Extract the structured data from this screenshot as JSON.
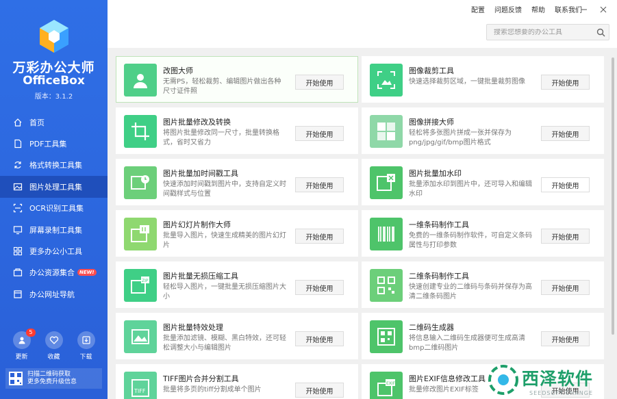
{
  "app": {
    "title": "万彩办公大师",
    "subtitle": "OfficeBox",
    "version": "版本：3.1.2"
  },
  "topmenu": [
    "配置",
    "问题反馈",
    "帮助",
    "联系我们"
  ],
  "search": {
    "placeholder": "搜索您想要的办公工具"
  },
  "nav": [
    {
      "label": "首页",
      "icon": "home-icon"
    },
    {
      "label": "PDF工具集",
      "icon": "pdf-icon"
    },
    {
      "label": "格式转换工具集",
      "icon": "convert-icon"
    },
    {
      "label": "图片处理工具集",
      "icon": "image-icon"
    },
    {
      "label": "OCR识别工具集",
      "icon": "ocr-icon"
    },
    {
      "label": "屏幕录制工具集",
      "icon": "monitor-icon"
    },
    {
      "label": "更多办公小工具",
      "icon": "grid-icon"
    },
    {
      "label": "办公资源集合",
      "icon": "resource-icon",
      "badge": "NEW!"
    },
    {
      "label": "办公网址导航",
      "icon": "nav-icon"
    }
  ],
  "bottom": {
    "update": {
      "label": "更新",
      "count": "5"
    },
    "favorite": {
      "label": "收藏"
    },
    "download": {
      "label": "下载"
    },
    "qr_line1": "扫描二维码获取",
    "qr_line2": "更多免费升级信息"
  },
  "button_label": "开始使用",
  "cards": [
    {
      "title": "改图大师",
      "desc": "无需PS，轻松裁剪、编辑图片做出各种尺寸证件照",
      "icon": "id-photo-icon",
      "color": "#4fcf88"
    },
    {
      "title": "图像裁剪工具",
      "desc": "快速选择裁剪区域，一键批量裁剪图像",
      "icon": "crop-frame-icon",
      "color": "#3fcf86"
    },
    {
      "title": "图片批量修改及转换",
      "desc": "将图片批量修改同一尺寸，批量转换格式，省时又省力",
      "icon": "crop-icon",
      "color": "#3fcf86"
    },
    {
      "title": "图像拼接大师",
      "desc": "轻松将多张图片拼成一张并保存为png/jpg/gif/bmp图片格式",
      "icon": "stitch-icon",
      "color": "#8fd8a8"
    },
    {
      "title": "图片批量加时间戳工具",
      "desc": "快速添加时间戳到图片中，支持自定义时间戳样式与位置",
      "icon": "timestamp-icon",
      "color": "#6ccf7a"
    },
    {
      "title": "图片批量加水印",
      "desc": "批量添加水印到图片中，还可导入和编辑水印",
      "icon": "watermark-icon",
      "color": "#4ec46a"
    },
    {
      "title": "图片幻灯片制作大师",
      "desc": "批量导入图片，快速生成精美的图片幻灯片",
      "icon": "slideshow-icon",
      "color": "#8fd870"
    },
    {
      "title": "一维条码制作工具",
      "desc": "免费的一维条码制作软件，可自定义条码属性与打印参数",
      "icon": "barcode-icon",
      "color": "#4ec46a"
    },
    {
      "title": "图片批量无损压缩工具",
      "desc": "轻松导入图片，一键批量无损压缩图片大小",
      "icon": "compress-icon",
      "color": "#3fcf86"
    },
    {
      "title": "二维条码制作工具",
      "desc": "快速创建专业的二维码与条码并保存为高清二维条码图片",
      "icon": "qrcode-icon",
      "color": "#6ccf7a"
    },
    {
      "title": "图片批量特效处理",
      "desc": "批量添加滤镜、模糊、黑白特效，还可轻松调整大小与编辑图片",
      "icon": "effect-icon",
      "color": "#5fd39a"
    },
    {
      "title": "二维码生成器",
      "desc": "将信息输入二维码生成器便可生成高清bmp二维码图片",
      "icon": "qr-generator-icon",
      "color": "#4ec46a"
    },
    {
      "title": "TIFF图片合并分割工具",
      "desc": "批量将多页的tiff分割成单个图片",
      "icon": "tiff-icon",
      "color": "#5fd39a"
    },
    {
      "title": "图片EXIF信息修改工具",
      "desc": "批量修改图片EXIF标签",
      "icon": "exif-icon",
      "color": "#4ec46a"
    }
  ],
  "watermark": {
    "main": "西泽软件",
    "sub": "SEEDSOFT.CHANGE"
  }
}
